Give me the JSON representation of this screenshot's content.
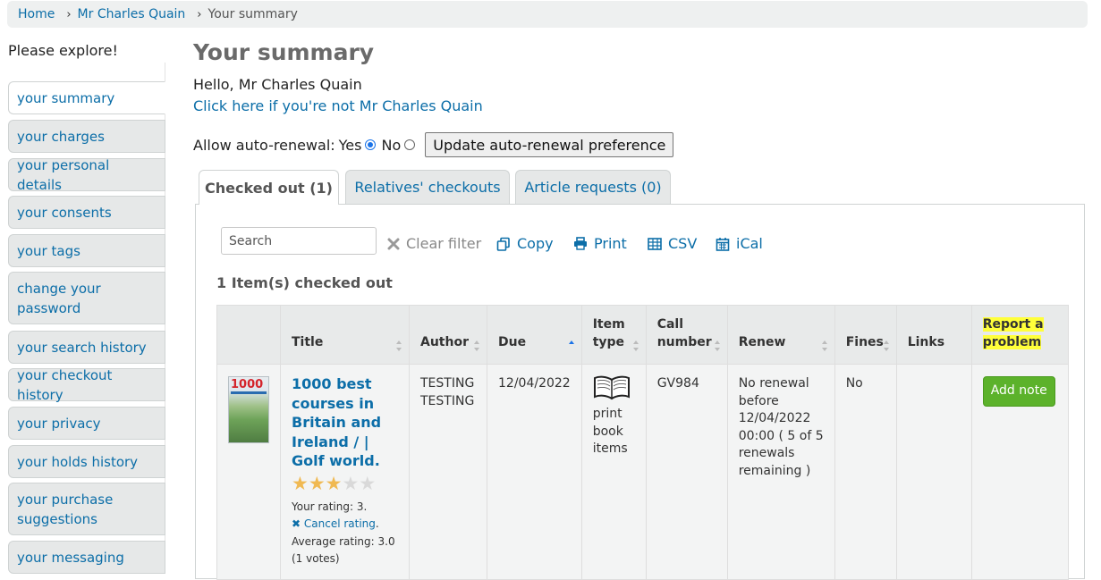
{
  "breadcrumb": {
    "home": "Home",
    "patron": "Mr Charles Quain",
    "current": "Your summary",
    "separator": "›"
  },
  "sidebar": {
    "title": "Please explore!",
    "items": [
      {
        "label": "your summary"
      },
      {
        "label": "your charges"
      },
      {
        "label": "your personal details"
      },
      {
        "label": "your consents"
      },
      {
        "label": "your tags"
      },
      {
        "label": "change your password"
      },
      {
        "label": "your search history"
      },
      {
        "label": "your checkout history"
      },
      {
        "label": "your privacy"
      },
      {
        "label": "your holds history"
      },
      {
        "label": "your purchase suggestions"
      },
      {
        "label": "your messaging"
      }
    ]
  },
  "main": {
    "title": "Your summary",
    "greeting": "Hello, Mr Charles Quain",
    "not_you_link": "Click here if you're not Mr Charles Quain",
    "auto_renewal": {
      "label": "Allow auto-renewal:",
      "yes": "Yes",
      "no": "No",
      "selected": "Yes",
      "button": "Update auto-renewal preference"
    }
  },
  "tabs": [
    {
      "label": "Checked out (1)",
      "active": true
    },
    {
      "label": "Relatives' checkouts",
      "active": false
    },
    {
      "label": "Article requests (0)",
      "active": false
    }
  ],
  "toolbar": {
    "search_placeholder": "Search",
    "clear_filter": "Clear filter",
    "copy": "Copy",
    "print": "Print",
    "csv": "CSV",
    "ical": "iCal"
  },
  "checkouts": {
    "count_text": "1 Item(s) checked out",
    "columns": {
      "title": "Title",
      "author": "Author",
      "due": "Due",
      "item_type": "Item type",
      "call_number": "Call number",
      "renew": "Renew",
      "fines": "Fines",
      "links": "Links",
      "report": "Report a problem"
    },
    "row": {
      "cover_text": "1000",
      "title": "1000 best courses in Britain and Ireland / | Golf world.",
      "rating_value": 3,
      "rating_max": 5,
      "your_rating": "Your rating: 3.",
      "cancel_rating": "Cancel rating",
      "average_rating": "Average rating: 3.0 (1 votes)",
      "author": "TESTING TESTING",
      "due": "12/04/2022",
      "item_type": "print book items",
      "call_number": "GV984",
      "renew": "No renewal before 12/04/2022 00:00 ( 5 of 5 renewals remaining )",
      "fines": "No",
      "links": "",
      "add_note": "Add note"
    }
  },
  "colors": {
    "link": "#0c6ea8",
    "add_note_bg": "#5cb22b",
    "highlight": "#ffff3a",
    "star_on": "#f0b952",
    "star_off": "#d9d9d9"
  }
}
